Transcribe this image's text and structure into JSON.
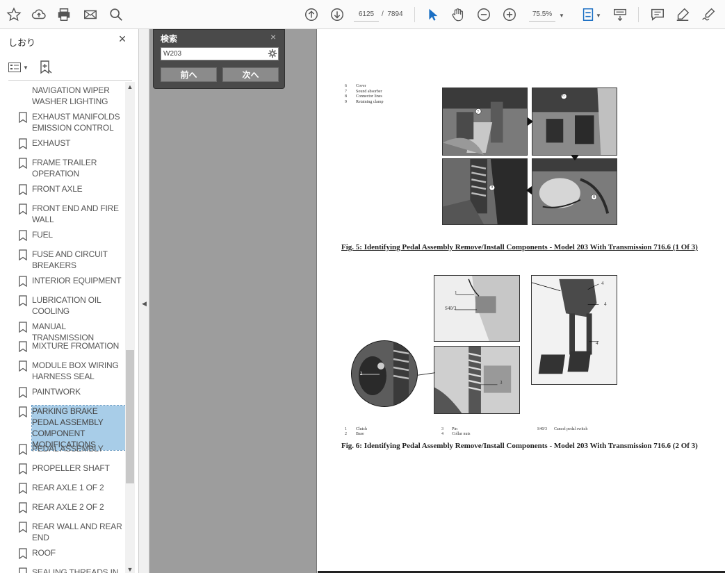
{
  "toolbar": {
    "current_page": "6125",
    "page_separator": "/",
    "total_pages": "7894",
    "zoom": "75.5%"
  },
  "sidebar": {
    "title": "しおり",
    "bookmarks": [
      {
        "label": "NAVIGATION WIPER WASHER LIGHTING",
        "icon": "bookmark-icon",
        "selected": false
      },
      {
        "label": "EXHAUST MANIFOLDS EMISSION CONTROL",
        "icon": "bookmark-icon",
        "selected": false
      },
      {
        "label": "EXHAUST",
        "icon": "bookmark-icon",
        "selected": false
      },
      {
        "label": "FRAME TRAILER OPERATION",
        "icon": "bookmark-icon",
        "selected": false
      },
      {
        "label": "FRONT AXLE",
        "icon": "bookmark-icon",
        "selected": false
      },
      {
        "label": "FRONT END AND FIRE WALL",
        "icon": "bookmark-icon",
        "selected": false
      },
      {
        "label": "FUEL",
        "icon": "bookmark-icon",
        "selected": false
      },
      {
        "label": "FUSE AND CIRCUIT BREAKERS",
        "icon": "bookmark-icon",
        "selected": false
      },
      {
        "label": "INTERIOR EQUIPMENT",
        "icon": "bookmark-icon",
        "selected": false
      },
      {
        "label": "LUBRICATION OIL COOLING",
        "icon": "bookmark-icon",
        "selected": false
      },
      {
        "label": "MANUAL TRANSMISSION",
        "icon": "bookmark-icon",
        "selected": false
      },
      {
        "label": "MIXTURE FROMATION",
        "icon": "bookmark-icon",
        "selected": false
      },
      {
        "label": "MODULE BOX WIRING HARNESS SEAL",
        "icon": "bookmark-icon",
        "selected": false
      },
      {
        "label": "PAINTWORK",
        "icon": "bookmark-icon",
        "selected": false
      },
      {
        "label": "PARKING BRAKE PEDAL ASSEMBLY COMPONENT MODIFICATIONS",
        "icon": "bookmark-icon",
        "selected": true
      },
      {
        "label": "PEDAL ASSEMBLY",
        "icon": "bookmark-icon",
        "selected": false
      },
      {
        "label": "PROPELLER SHAFT",
        "icon": "bookmark-icon",
        "selected": false
      },
      {
        "label": "REAR AXLE 1 OF 2",
        "icon": "bookmark-icon",
        "selected": false
      },
      {
        "label": "REAR AXLE 2 OF 2",
        "icon": "bookmark-icon",
        "selected": false
      },
      {
        "label": "REAR WALL AND REAR END",
        "icon": "bookmark-icon",
        "selected": false
      },
      {
        "label": "ROOF",
        "icon": "bookmark-icon",
        "selected": false
      },
      {
        "label": "SEALING THREADS IN",
        "icon": "bookmark-icon",
        "selected": false
      }
    ]
  },
  "search": {
    "title": "検索",
    "query": "W203",
    "prev_label": "前へ",
    "next_label": "次へ"
  },
  "document": {
    "fig5_legend": [
      {
        "num": "6",
        "text": "Cover"
      },
      {
        "num": "7",
        "text": "Sound absorber"
      },
      {
        "num": "8",
        "text": "Connector lines"
      },
      {
        "num": "9",
        "text": "Retaining clamp"
      }
    ],
    "fig5_caption": "Fig. 5: Identifying Pedal Assembly Remove/Install Components - Model 203 With Transmission 716.6 (1 Of 3)",
    "fig6_legend": [
      {
        "num": "1",
        "text": "Clutch"
      },
      {
        "num": "2",
        "text": "Base"
      },
      {
        "num": "3",
        "text": "Pin"
      },
      {
        "num": "4",
        "text": "Collar nuts"
      },
      {
        "num": "S40/3",
        "text": "Cancel pedal switch"
      }
    ],
    "fig6_caption": "Fig. 6: Identifying Pedal Assembly Remove/Install Components - Model 203 With Transmission 716.6 (2 Of 3)",
    "fig6_callouts": [
      "1",
      "S40/3",
      "4",
      "4",
      "2",
      "3",
      "4"
    ],
    "fig5_callouts": [
      "7",
      "6",
      "9",
      "8"
    ]
  }
}
